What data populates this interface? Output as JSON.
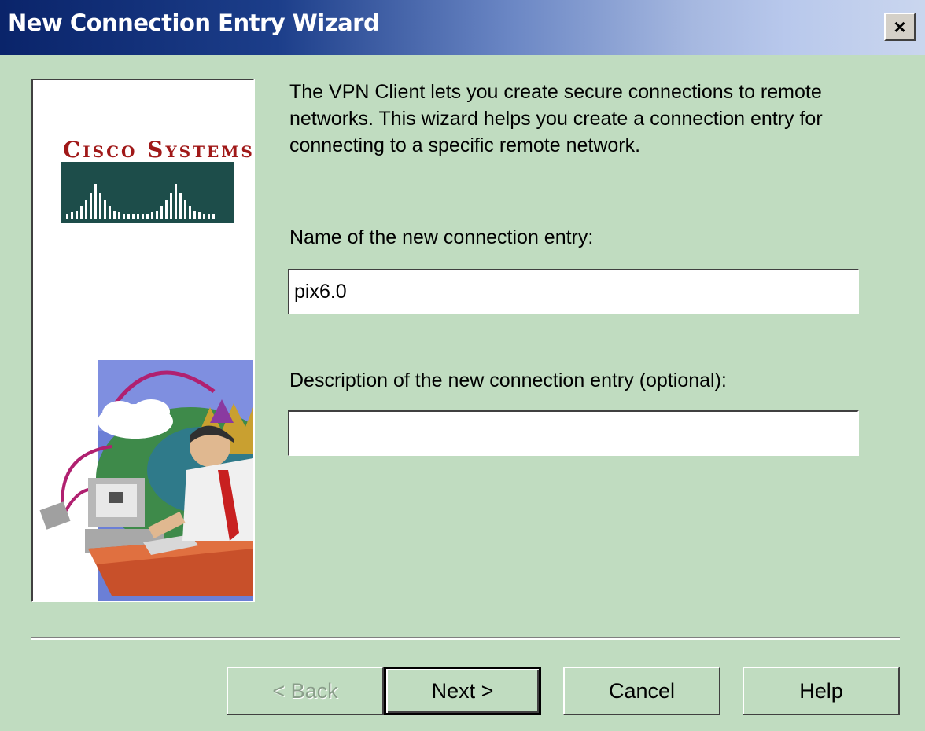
{
  "window": {
    "title": "New Connection Entry Wizard",
    "close_label": "×"
  },
  "logo": {
    "text": "Cisco Systems"
  },
  "intro": {
    "text": "The VPN Client lets you create secure connections to remote networks. This wizard helps you create a connection entry for connecting to a specific remote network."
  },
  "name_field": {
    "label": "Name of the new connection entry:",
    "value": "pix6.0"
  },
  "description_field": {
    "label": "Description of the new connection entry (optional):",
    "value": ""
  },
  "buttons": {
    "back": "< Back",
    "next": "Next >",
    "cancel": "Cancel",
    "help": "Help"
  },
  "colors": {
    "dialog_background": "#c0dcc0",
    "titlebar_start": "#0a246a",
    "titlebar_end": "#cad6ee",
    "logo_red": "#a01818",
    "logo_bars": "#1d4d4a"
  }
}
